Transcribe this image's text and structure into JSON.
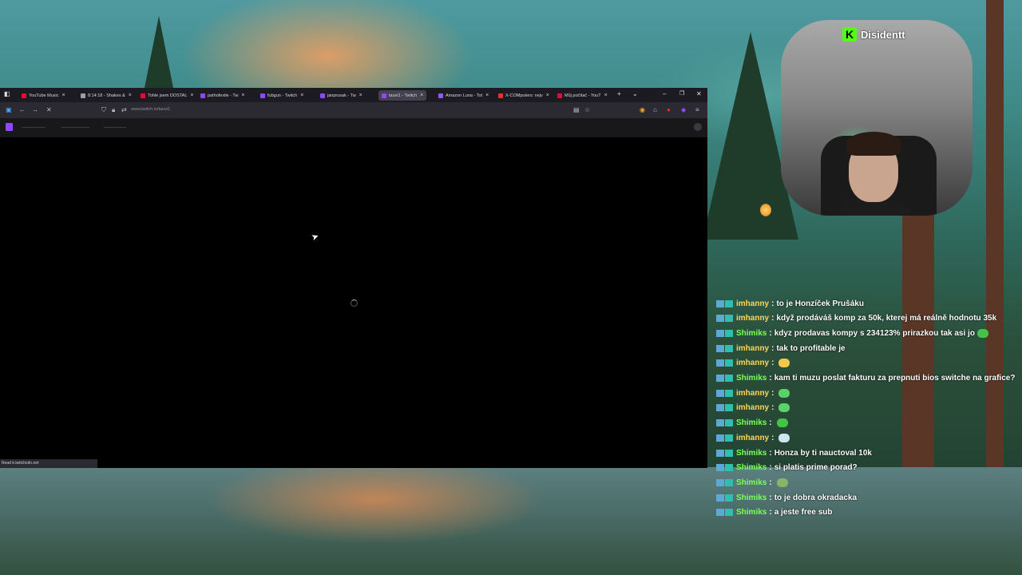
{
  "tabs": [
    {
      "label": "YouTube Music",
      "color": "#ff0033",
      "active": false
    },
    {
      "label": "8:14:18 - Shakes &",
      "color": "#9aa0a6",
      "active": false
    },
    {
      "label": "Tohle jsem DOSTAL",
      "color": "#ff0033",
      "active": false
    },
    {
      "label": "pathofexile - Tw",
      "color": "#9146ff",
      "active": false
    },
    {
      "label": "fubgun - Twitch",
      "color": "#9146ff",
      "active": false
    },
    {
      "label": "janprusak - Tw",
      "color": "#9146ff",
      "active": false
    },
    {
      "label": "tauvi1 - Twitch",
      "color": "#9146ff",
      "active": true
    },
    {
      "label": "Amazon Luna - Tot",
      "color": "#8a5cff",
      "active": false
    },
    {
      "label": "X-COMputers: nejv",
      "color": "#e8312f",
      "active": false
    },
    {
      "label": "Můj počítač - YouT",
      "color": "#ff0033",
      "active": false
    }
  ],
  "browser": {
    "url": "www.twitch.tv/tauvi1",
    "status": "Read k.twitchcdn.net"
  },
  "overlay": {
    "streamer": "Disidentt",
    "logo_letter": "K"
  },
  "chat": [
    {
      "user": "imhanny",
      "text": "to je Honzíček Prušáku",
      "color": "#ffd45a"
    },
    {
      "user": "imhanny",
      "text": "když prodáváš komp za 50k, kterej má reálně hodnotu 35k",
      "color": "#ffd45a"
    },
    {
      "user": "Shimiks",
      "text": "kdyz prodavas kompy s 234123% prirazkou tak asi jo",
      "color": "#7dff5a",
      "emote": "#43c447"
    },
    {
      "user": "imhanny",
      "text": "tak to profitable je",
      "color": "#ffd45a"
    },
    {
      "user": "imhanny",
      "text": "",
      "color": "#ffd45a",
      "emote": "#f2c84b"
    },
    {
      "user": "Shimiks",
      "text": "kam ti muzu poslat fakturu za prepnuti bios switche na grafice?",
      "color": "#7dff5a"
    },
    {
      "user": "imhanny",
      "text": "",
      "color": "#ffd45a",
      "emote": "#5ad26a"
    },
    {
      "user": "imhanny",
      "text": "",
      "color": "#ffd45a",
      "emote": "#5ad26a"
    },
    {
      "user": "Shimiks",
      "text": "",
      "color": "#7dff5a",
      "emote": "#43c447"
    },
    {
      "user": "imhanny",
      "text": "",
      "color": "#ffd45a",
      "emote": "#cfe6f2"
    },
    {
      "user": "Shimiks",
      "text": "Honza by ti nauctoval 10k",
      "color": "#7dff5a"
    },
    {
      "user": "Shimiks",
      "text": "si platis prime porad?",
      "color": "#7dff5a"
    },
    {
      "user": "Shimiks",
      "text": "",
      "color": "#7dff5a",
      "emote": "#8ab36a"
    },
    {
      "user": "Shimiks",
      "text": "to je dobra okradacka",
      "color": "#7dff5a"
    },
    {
      "user": "Shimiks",
      "text": "a jeste free sub",
      "color": "#7dff5a"
    }
  ]
}
